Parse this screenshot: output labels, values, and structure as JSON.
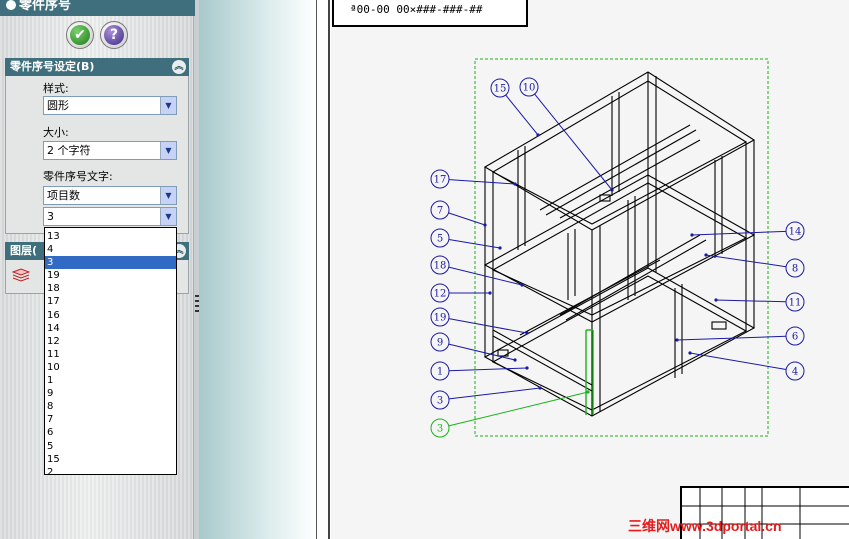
{
  "panel": {
    "title": "零件序号",
    "ok_icon": "check-icon",
    "help_icon": "question-icon",
    "settings_group": {
      "title": "零件序号设定(B)",
      "style_label": "样式:",
      "style_value": "圆形",
      "size_label": "大小:",
      "size_value": "2 个字符",
      "text_label": "零件序号文字:",
      "text_value": "项目数",
      "number_value": "3"
    },
    "layer_group": {
      "title": "图层("
    },
    "dropdown_items": [
      "13",
      "4",
      "3",
      "19",
      "18",
      "17",
      "16",
      "14",
      "12",
      "11",
      "10",
      "1",
      "9",
      "8",
      "7",
      "6",
      "5",
      "15",
      "2"
    ],
    "dropdown_selected_index": 2
  },
  "drawing": {
    "title_text": "ª00-00 00×###-###-##",
    "balloons": [
      {
        "label": "15"
      },
      {
        "label": "10"
      },
      {
        "label": "17"
      },
      {
        "label": "7"
      },
      {
        "label": "5"
      },
      {
        "label": "18"
      },
      {
        "label": "12"
      },
      {
        "label": "19"
      },
      {
        "label": "9"
      },
      {
        "label": "1"
      },
      {
        "label": "3"
      },
      {
        "label": "3",
        "highlighted": true
      },
      {
        "label": "14"
      },
      {
        "label": "8"
      },
      {
        "label": "11"
      },
      {
        "label": "6"
      },
      {
        "label": "4"
      }
    ]
  },
  "watermark": "三维网www.3dportal.cn",
  "colors": {
    "panel_header": "#3f6f7c",
    "balloon": "#1a1aa6",
    "highlight": "#19b319",
    "selection": "#316ac5",
    "watermark": "#e31d1d"
  }
}
